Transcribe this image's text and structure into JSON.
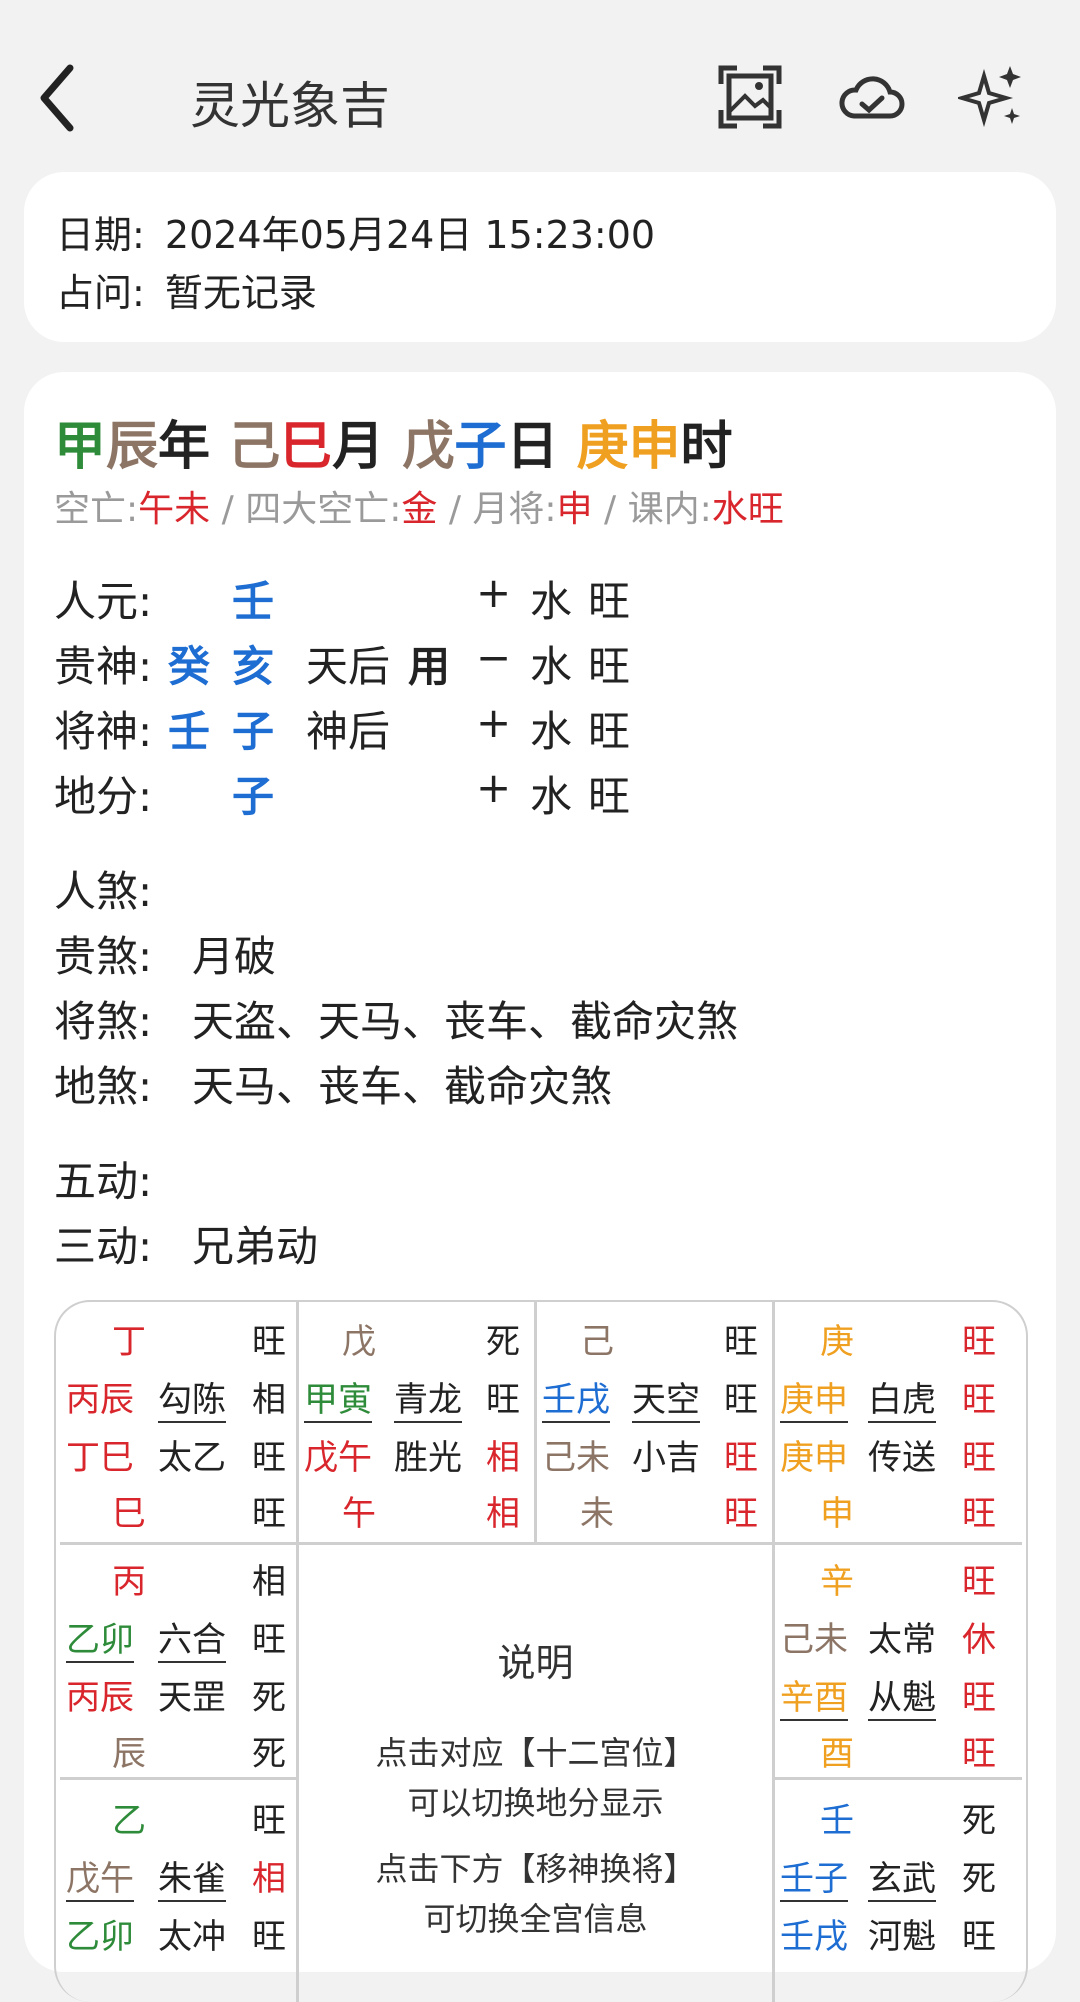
{
  "app": {
    "title": "灵光象吉"
  },
  "info": {
    "date_label": "日期:",
    "date_value": "2024年05月24日 15:23:00",
    "ask_label": "占问:",
    "ask_value": "暂无记录"
  },
  "pillars": {
    "year_gan": "甲",
    "year_zhi": "辰",
    "year_suffix": "年",
    "month_gan": "己",
    "month_zhi": "巳",
    "month_suffix": "月",
    "day_gan": "戊",
    "day_zhi": "子",
    "day_suffix": "日",
    "hour_gan": "庚",
    "hour_zhi": "申",
    "hour_suffix": "时"
  },
  "kong": {
    "k1_label": "空亡:",
    "k1_value": "午未",
    "sep": "/",
    "k2_label": "四大空亡:",
    "k2_value": "金",
    "k3_label": "月将:",
    "k3_value": "申",
    "k4_label": "课内:",
    "k4_value": "水旺"
  },
  "rows": [
    {
      "label": "人元:",
      "a": "",
      "b": "壬",
      "name": "",
      "yong": "",
      "sign": "+",
      "wx": "水",
      "ws": "旺"
    },
    {
      "label": "贵神:",
      "a": "癸",
      "b": "亥",
      "name": "天后",
      "yong": "用",
      "sign": "−",
      "wx": "水",
      "ws": "旺"
    },
    {
      "label": "将神:",
      "a": "壬",
      "b": "子",
      "name": "神后",
      "yong": "",
      "sign": "+",
      "wx": "水",
      "ws": "旺"
    },
    {
      "label": "地分:",
      "a": "",
      "b": "子",
      "name": "",
      "yong": "",
      "sign": "+",
      "wx": "水",
      "ws": "旺"
    }
  ],
  "sha": [
    {
      "label": "人煞:",
      "value": ""
    },
    {
      "label": "贵煞:",
      "value": "月破"
    },
    {
      "label": "将煞:",
      "value": "天盗、天马、丧车、截命灾煞"
    },
    {
      "label": "地煞:",
      "value": "天马、丧车、截命灾煞"
    }
  ],
  "dong": [
    {
      "label": "五动:",
      "value": ""
    },
    {
      "label": "三动:",
      "value": "兄弟动"
    }
  ],
  "palaces": {
    "p1": {
      "top": "丁",
      "top_s": "旺",
      "r1a": "丙辰",
      "r1b": "勾陈",
      "r1s": "相",
      "r2a": "丁巳",
      "r2b": "太乙",
      "r2s": "旺",
      "bot": "巳",
      "bot_s": "旺"
    },
    "p2": {
      "top": "戊",
      "top_s": "死",
      "r1a": "甲寅",
      "r1b": "青龙",
      "r1s": "旺",
      "r2a": "戊午",
      "r2b": "胜光",
      "r2s": "相",
      "bot": "午",
      "bot_s": "相"
    },
    "p3": {
      "top": "己",
      "top_s": "旺",
      "r1a": "壬戌",
      "r1b": "天空",
      "r1s": "旺",
      "r2a": "己未",
      "r2b": "小吉",
      "r2s": "旺",
      "bot": "未",
      "bot_s": "旺"
    },
    "p4": {
      "top": "庚",
      "top_s": "旺",
      "r1a": "庚申",
      "r1b": "白虎",
      "r1s": "旺",
      "r2a": "庚申",
      "r2b": "传送",
      "r2s": "旺",
      "bot": "申",
      "bot_s": "旺"
    },
    "p5": {
      "top": "丙",
      "top_s": "相",
      "r1a": "乙卯",
      "r1b": "六合",
      "r1s": "旺",
      "r2a": "丙辰",
      "r2b": "天罡",
      "r2s": "死",
      "bot": "辰",
      "bot_s": "死"
    },
    "p6": {
      "top": "辛",
      "top_s": "旺",
      "r1a": "己未",
      "r1b": "太常",
      "r1s": "休",
      "r2a": "辛酉",
      "r2b": "从魁",
      "r2s": "旺",
      "bot": "酉",
      "bot_s": "旺"
    },
    "p7": {
      "top": "乙",
      "top_s": "旺",
      "r1a": "戊午",
      "r1b": "朱雀",
      "r1s": "相",
      "r2a": "乙卯",
      "r2b": "太冲",
      "r2s": "旺"
    },
    "p8": {
      "top": "壬",
      "top_s": "死",
      "r1a": "壬子",
      "r1b": "玄武",
      "r1s": "死",
      "r2a": "壬戌",
      "r2b": "河魁",
      "r2s": "旺"
    }
  },
  "explain": {
    "title": "说明",
    "l1": "点击对应【十二宫位】",
    "l2": "可以切换地分显示",
    "l3": "点击下方【移神换将】",
    "l4": "可切换全宫信息"
  },
  "icons": {
    "back": "back-arrow-icon",
    "image": "image-frame-icon",
    "cloud": "cloud-check-icon",
    "sparkle": "sparkle-icon"
  }
}
